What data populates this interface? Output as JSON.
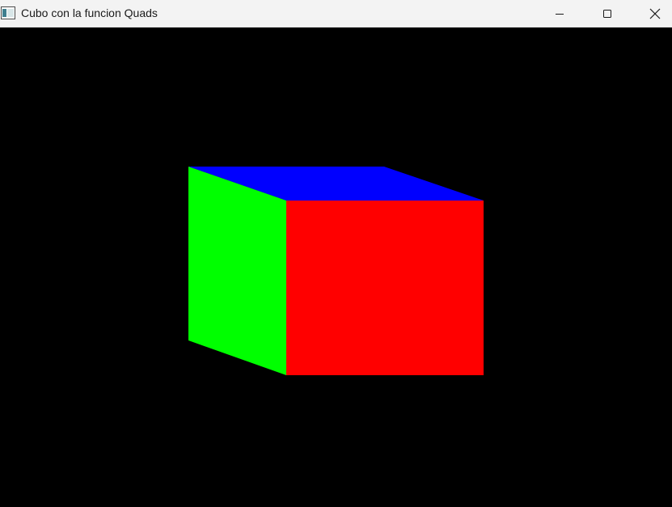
{
  "window": {
    "title": "Cubo con la funcion Quads",
    "icon": "app-window-icon",
    "controls": {
      "minimize_icon": "minimize-icon",
      "maximize_icon": "maximize-icon",
      "close_icon": "close-icon"
    }
  },
  "canvas": {
    "background": "#000000",
    "faces": {
      "front": {
        "color": "#ff0000"
      },
      "left": {
        "color": "#00ff00"
      },
      "top": {
        "color": "#0000ff"
      }
    }
  }
}
